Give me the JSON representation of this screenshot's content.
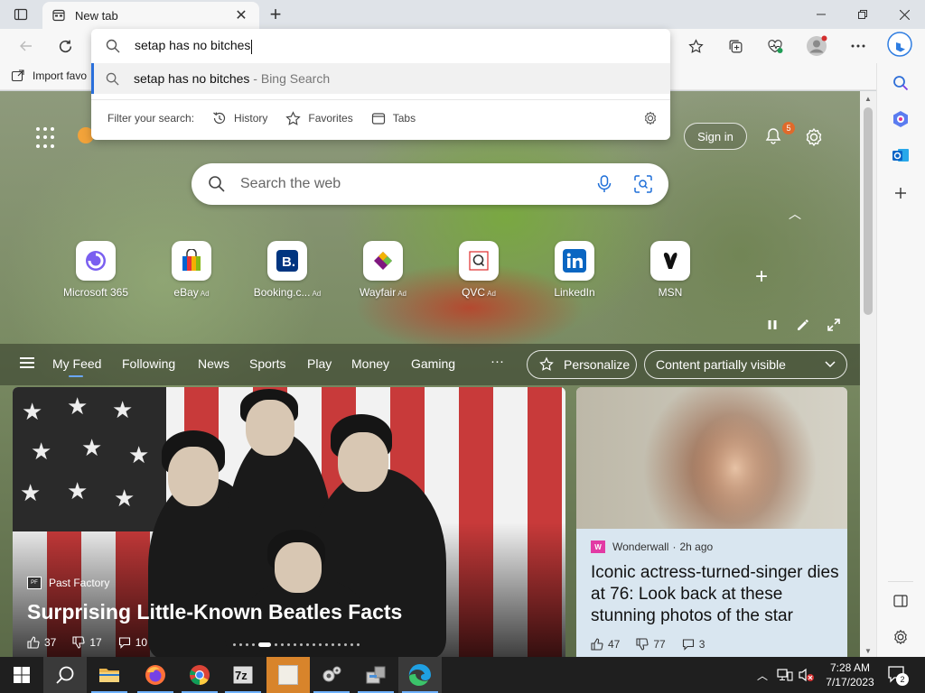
{
  "browser": {
    "tab": {
      "title": "New tab"
    },
    "favorites_bar": {
      "import_label": "Import favo"
    }
  },
  "omnibox": {
    "query": "setap has no bitches",
    "suggestion": {
      "text": "setap has no bitches",
      "suffix": " - Bing Search"
    },
    "filter": {
      "label": "Filter your search:",
      "history": "History",
      "favorites": "Favorites",
      "tabs": "Tabs"
    }
  },
  "newtab": {
    "signin_label": "Sign in",
    "notification_count": "5",
    "search_placeholder": "Search the web",
    "tiles": [
      {
        "label": "Microsoft 365",
        "ad": ""
      },
      {
        "label": "eBay",
        "ad": "Ad"
      },
      {
        "label": "Booking.c...",
        "ad": "Ad"
      },
      {
        "label": "Wayfair",
        "ad": "Ad"
      },
      {
        "label": "QVC",
        "ad": "Ad"
      },
      {
        "label": "LinkedIn",
        "ad": ""
      },
      {
        "label": "MSN",
        "ad": ""
      }
    ],
    "feed_tabs": [
      "My Feed",
      "Following",
      "News",
      "Sports",
      "Play",
      "Money",
      "Gaming"
    ],
    "more_label": "···",
    "personalize_label": "Personalize",
    "content_visibility_label": "Content partially visible"
  },
  "cards": {
    "main": {
      "source": "Past Factory",
      "headline": "Surprising Little-Known Beatles Facts",
      "likes": "37",
      "dislikes": "17",
      "comments": "10"
    },
    "side": {
      "source": "Wonderwall",
      "time": "2h ago",
      "headline": "Iconic actress-turned-singer dies at 76: Look back at these stunning photos of the star",
      "likes": "47",
      "dislikes": "77",
      "comments": "3"
    }
  },
  "taskbar": {
    "time": "7:28 AM",
    "date": "7/17/2023",
    "notification_count": "2"
  },
  "colors": {
    "accent": "#2a6fdb",
    "badge": "#e06a2b",
    "taskbar": "#1f1f1f"
  }
}
